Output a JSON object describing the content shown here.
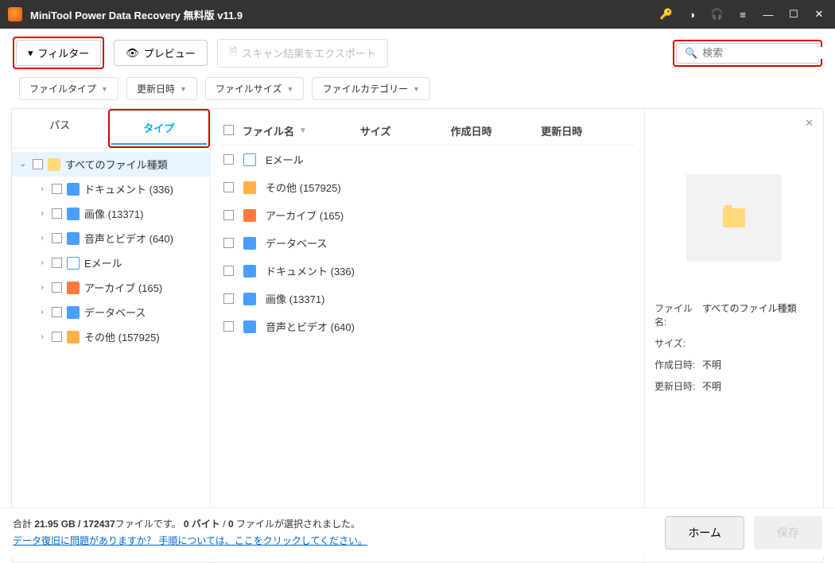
{
  "title": "MiniTool Power Data Recovery 無料版 v11.9",
  "toolbar": {
    "filter": "フィルター",
    "preview": "プレビュー",
    "export": "スキャン結果をエクスポート",
    "search_placeholder": "検索"
  },
  "chips": [
    "ファイルタイプ",
    "更新日時",
    "ファイルサイズ",
    "ファイルカテゴリー"
  ],
  "tabs": {
    "path": "パス",
    "type": "タイプ"
  },
  "tree_root": "すべてのファイル種類",
  "tree": [
    {
      "label": "ドキュメント (336)",
      "ico": "ico-doc"
    },
    {
      "label": "画像 (13371)",
      "ico": "ico-img"
    },
    {
      "label": "音声とビデオ (640)",
      "ico": "ico-av"
    },
    {
      "label": "Eメール",
      "ico": "ico-mail"
    },
    {
      "label": "アーカイブ (165)",
      "ico": "ico-arc"
    },
    {
      "label": "データベース",
      "ico": "ico-db"
    },
    {
      "label": "その他 (157925)",
      "ico": "ico-other"
    }
  ],
  "columns": {
    "name": "ファイル名",
    "size": "サイズ",
    "created": "作成日時",
    "modified": "更新日時"
  },
  "rows": [
    {
      "label": "Eメール",
      "ico": "ico-mail"
    },
    {
      "label": "その他 (157925)",
      "ico": "ico-other"
    },
    {
      "label": "アーカイブ (165)",
      "ico": "ico-arc"
    },
    {
      "label": "データベース",
      "ico": "ico-db"
    },
    {
      "label": "ドキュメント (336)",
      "ico": "ico-doc"
    },
    {
      "label": "画像 (13371)",
      "ico": "ico-img"
    },
    {
      "label": "音声とビデオ (640)",
      "ico": "ico-av"
    }
  ],
  "detail": {
    "name_lbl": "ファイル名:",
    "name_val": "すべてのファイル種類",
    "size_lbl": "サイズ:",
    "size_val": "",
    "created_lbl": "作成日時:",
    "created_val": "不明",
    "modified_lbl": "更新日時:",
    "modified_val": "不明"
  },
  "footer": {
    "line1_a": "合計 ",
    "line1_b": "21.95 GB / 172437",
    "line1_c": "ファイルです。 ",
    "line1_d": "0 バイト",
    "line1_e": " / ",
    "line1_f": "0",
    "line1_g": " ファイルが選択されました。",
    "link": "データ復旧に問題がありますか？ 手順については、ここをクリックしてください。",
    "home": "ホーム",
    "save": "保存"
  }
}
